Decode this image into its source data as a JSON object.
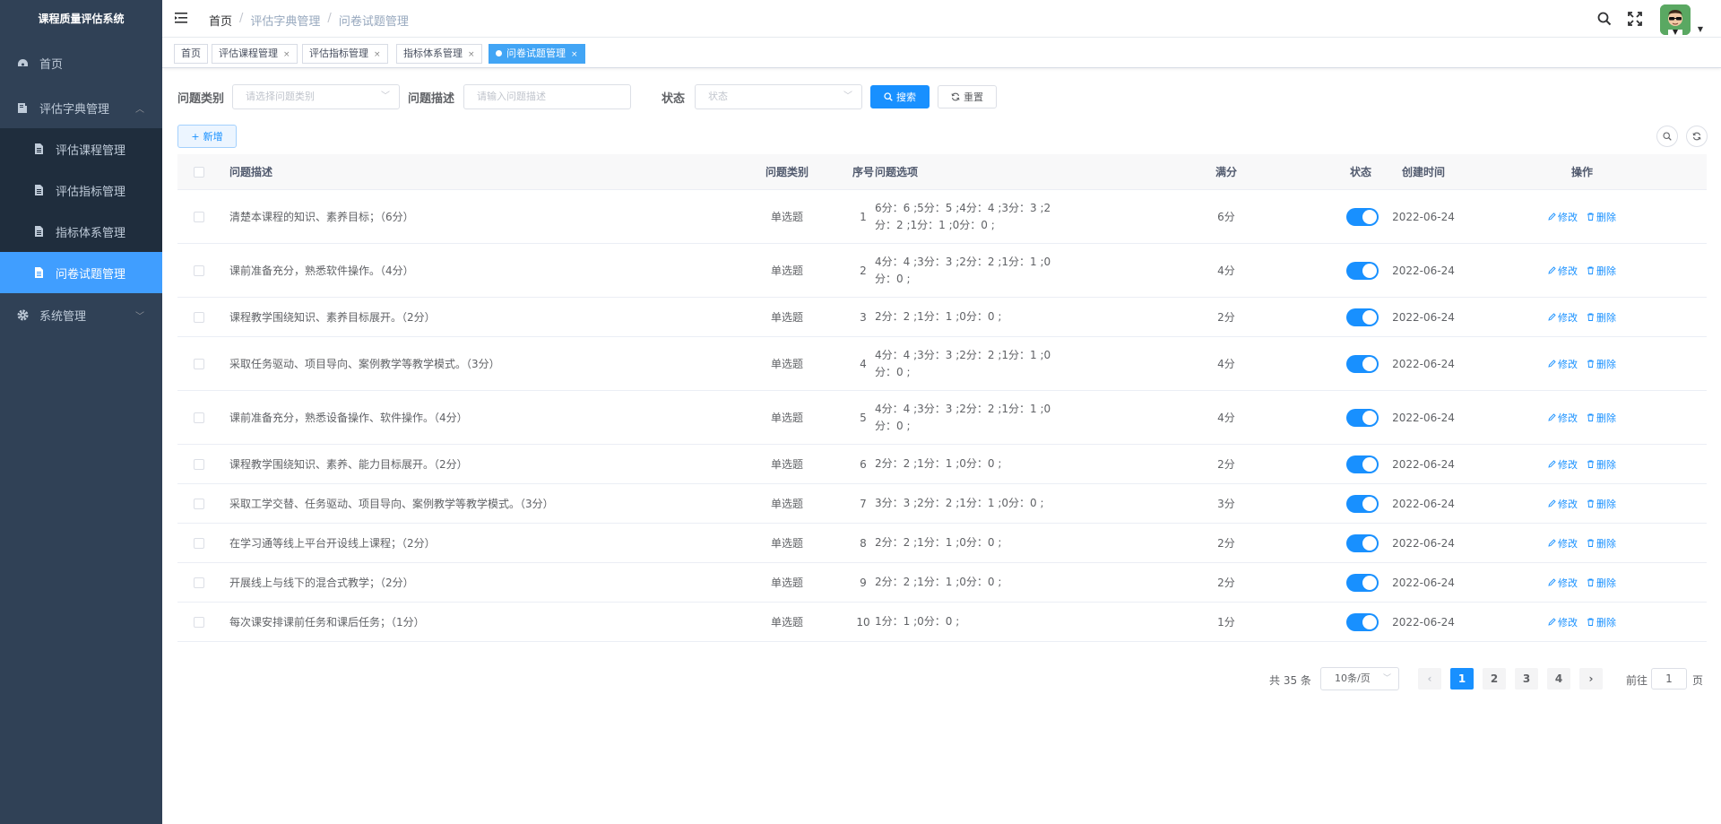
{
  "app_title": "课程质量评估系统",
  "sidebar": {
    "items": [
      {
        "label": "首页",
        "icon": "dashboard-icon"
      },
      {
        "label": "评估字典管理",
        "icon": "dictionary-icon"
      },
      {
        "label": "评估课程管理",
        "icon": "document-icon"
      },
      {
        "label": "评估指标管理",
        "icon": "document-icon"
      },
      {
        "label": "指标体系管理",
        "icon": "document-icon"
      },
      {
        "label": "问卷试题管理",
        "icon": "document-icon"
      },
      {
        "label": "系统管理",
        "icon": "gear-icon"
      }
    ]
  },
  "breadcrumb": [
    "首页",
    "评估字典管理",
    "问卷试题管理"
  ],
  "breadcrumb_sep": "/",
  "tags": [
    {
      "label": "首页",
      "close": ""
    },
    {
      "label": "评估课程管理",
      "close": "×"
    },
    {
      "label": "评估指标管理",
      "close": "×"
    },
    {
      "label": "指标体系管理",
      "close": "×"
    },
    {
      "label": "问卷试题管理",
      "close": "×"
    }
  ],
  "search": {
    "category_label": "问题类别",
    "category_placeholder": "请选择问题类别",
    "desc_label": "问题描述",
    "desc_placeholder": "请输入问题描述",
    "status_label": "状态",
    "status_placeholder": "状态",
    "search_btn": "搜索",
    "reset_btn": "重置",
    "add_btn": "新增",
    "add_plus": "+"
  },
  "table": {
    "headers": [
      "问题描述",
      "问题类别",
      "序号",
      "问题选项",
      "满分",
      "状态",
      "创建时间",
      "操作"
    ],
    "edit_label": "修改",
    "delete_label": "删除",
    "rows": [
      {
        "desc": "清楚本课程的知识、素养目标；（6分）",
        "type": "单选题",
        "seq": "1",
        "opts": [
          "6分：6 ;5分：5 ;4分：4 ;3分：3 ;2",
          "分：2 ;1分：1 ;0分：0 ;"
        ],
        "score": "6分",
        "status": true,
        "date": "2022-06-24"
      },
      {
        "desc": "课前准备充分，熟悉软件操作。（4分）",
        "type": "单选题",
        "seq": "2",
        "opts": [
          "4分：4 ;3分：3 ;2分：2 ;1分：1 ;0",
          "分：0 ;"
        ],
        "score": "4分",
        "status": true,
        "date": "2022-06-24"
      },
      {
        "desc": "课程教学围绕知识、素养目标展开。（2分）",
        "type": "单选题",
        "seq": "3",
        "opts": [
          "2分：2 ;1分：1 ;0分：0 ;"
        ],
        "score": "2分",
        "status": true,
        "date": "2022-06-24"
      },
      {
        "desc": "采取任务驱动、项目导向、案例教学等教学模式。（3分）",
        "type": "单选题",
        "seq": "4",
        "opts": [
          "4分：4 ;3分：3 ;2分：2 ;1分：1 ;0",
          "分：0 ;"
        ],
        "score": "4分",
        "status": true,
        "date": "2022-06-24"
      },
      {
        "desc": "课前准备充分，熟悉设备操作、软件操作。（4分）",
        "type": "单选题",
        "seq": "5",
        "opts": [
          "4分：4 ;3分：3 ;2分：2 ;1分：1 ;0",
          "分：0 ;"
        ],
        "score": "4分",
        "status": true,
        "date": "2022-06-24"
      },
      {
        "desc": "课程教学围绕知识、素养、能力目标展开。（2分）",
        "type": "单选题",
        "seq": "6",
        "opts": [
          "2分：2 ;1分：1 ;0分：0 ;"
        ],
        "score": "2分",
        "status": true,
        "date": "2022-06-24"
      },
      {
        "desc": "采取工学交替、任务驱动、项目导向、案例教学等教学模式。（3分）",
        "type": "单选题",
        "seq": "7",
        "opts": [
          "3分：3 ;2分：2 ;1分：1 ;0分：0 ;"
        ],
        "score": "3分",
        "status": true,
        "date": "2022-06-24"
      },
      {
        "desc": "在学习通等线上平台开设线上课程；（2分）",
        "type": "单选题",
        "seq": "8",
        "opts": [
          "2分：2 ;1分：1 ;0分：0 ;"
        ],
        "score": "2分",
        "status": true,
        "date": "2022-06-24"
      },
      {
        "desc": "开展线上与线下的混合式教学；（2分）",
        "type": "单选题",
        "seq": "9",
        "opts": [
          "2分：2 ;1分：1 ;0分：0 ;"
        ],
        "score": "2分",
        "status": true,
        "date": "2022-06-24"
      },
      {
        "desc": "每次课安排课前任务和课后任务；（1分）",
        "type": "单选题",
        "seq": "10",
        "opts": [
          "1分：1 ;0分：0 ;"
        ],
        "score": "1分",
        "status": true,
        "date": "2022-06-24"
      }
    ]
  },
  "pagination": {
    "total": "共 35 条",
    "page_size": "10条/页",
    "pages": [
      "1",
      "2",
      "3",
      "4"
    ],
    "current": "1",
    "prev": "‹",
    "next": "›",
    "goto_label": "前往",
    "goto_value": "1",
    "goto_suffix": "页"
  },
  "colors": {
    "primary": "#1890ff",
    "sidebar_bg": "#304156",
    "sidebar_active": "#409eff"
  }
}
